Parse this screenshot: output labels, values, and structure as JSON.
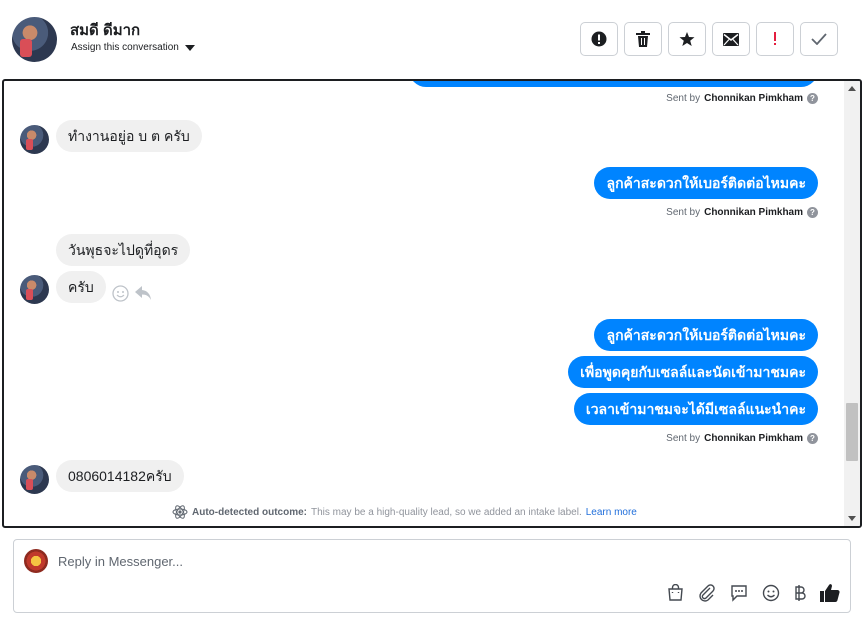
{
  "header": {
    "contact_name": "สมดี ดีมาก",
    "assign_label": "Assign this conversation",
    "toolbar": [
      {
        "icon": "alert-circle-icon",
        "name": "spam-button"
      },
      {
        "icon": "trash-icon",
        "name": "delete-button"
      },
      {
        "icon": "star-icon",
        "name": "star-button"
      },
      {
        "icon": "envelope-icon",
        "name": "mark-unread-button"
      },
      {
        "icon": "exclamation-icon",
        "name": "follow-up-button"
      },
      {
        "icon": "check-icon",
        "name": "mark-done-button"
      }
    ]
  },
  "conversation": {
    "sent_by_prefix": "Sent by",
    "sender": "Chonnikan Pimkham",
    "messages": [
      {
        "dir": "in",
        "text": "ทำงานอยู่อ  บ ต ครับ"
      },
      {
        "dir": "out",
        "text": "ลูกค้าสะดวกให้เบอร์ติดต่อไหมคะ"
      },
      {
        "dir": "in",
        "text": "วันพุธจะไปดูที่อุดร"
      },
      {
        "dir": "in",
        "text": "ครับ"
      },
      {
        "dir": "out",
        "text": "ลูกค้าสะดวกให้เบอร์ติดต่อไหมคะ"
      },
      {
        "dir": "out",
        "text": "เพื่อพูดคุยกับเซลล์และนัดเข้ามาชมคะ"
      },
      {
        "dir": "out",
        "text": "เวลาเข้ามาชมจะได้มีเซลล์แนะนำคะ"
      },
      {
        "dir": "in",
        "text": "0806014182ครับ"
      }
    ],
    "outcome": {
      "label": "Auto-detected outcome:",
      "text": "This may be a high-quality lead, so we added an intake label.",
      "link": "Learn more"
    }
  },
  "composer": {
    "placeholder": "Reply in Messenger...",
    "tools": [
      "shopping-bag-icon",
      "paperclip-icon",
      "saved-reply-icon",
      "emoji-icon",
      "baht-icon",
      "thumbs-up-icon"
    ]
  },
  "colors": {
    "accent": "#0084ff",
    "incoming_bubble": "#f0f0f0",
    "link": "#216fdb"
  }
}
